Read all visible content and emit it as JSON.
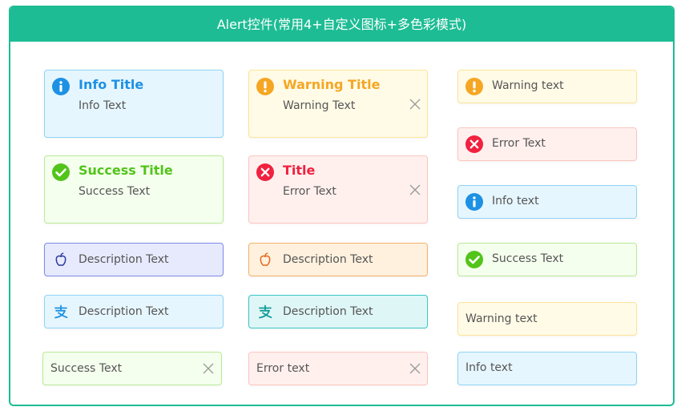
{
  "header": {
    "title": "Alert控件(常用4+自定义图标+多色彩模式)"
  },
  "colors": {
    "accent": "#1dbc94",
    "info": "#1d91e4",
    "warning": "#f5a623",
    "error": "#f1213f",
    "success": "#52c41a",
    "purple": "#2d3a9b",
    "orange": "#e8691b",
    "teal": "#119b96"
  },
  "alerts": {
    "info_title": {
      "title": "Info Title",
      "text": "Info Text"
    },
    "warning_title": {
      "title": "Warning Title",
      "text": "Warning Text"
    },
    "success_title": {
      "title": "Success Title",
      "text": "Success Text"
    },
    "error_title": {
      "title": "Title",
      "text": "Error Text"
    },
    "apple_purple": {
      "text": "Description Text",
      "icon": "apple-icon"
    },
    "apple_orange": {
      "text": "Description Text",
      "icon": "apple-icon"
    },
    "alipay_blue": {
      "text": "Description Text",
      "icon": "alipay-icon"
    },
    "alipay_teal": {
      "text": "Description Text",
      "icon": "alipay-icon"
    },
    "success_plain": {
      "text": "Success Text"
    },
    "error_plain": {
      "text": "Error text"
    },
    "warning_icon": {
      "text": "Warning text"
    },
    "error_icon": {
      "text": "Error Text"
    },
    "info_icon": {
      "text": "Info text"
    },
    "success_icon": {
      "text": "Success Text"
    },
    "warning_plain": {
      "text": "Warning text"
    },
    "info_plain": {
      "text": "Info text"
    }
  }
}
